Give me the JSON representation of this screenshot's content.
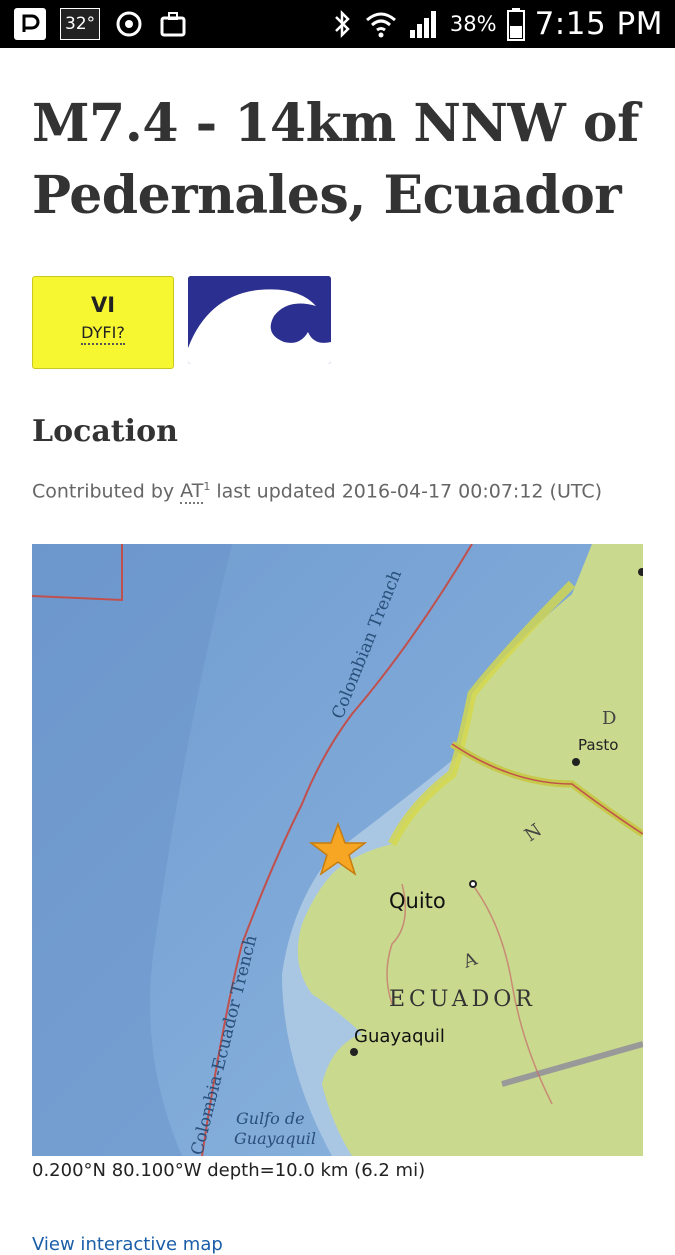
{
  "status_bar": {
    "temperature": "32°",
    "battery": "38%",
    "time": "7:15 PM"
  },
  "event": {
    "title": "M7.4 - 14km NNW of Pedernales, Ecuador"
  },
  "badges": {
    "dyfi_level": "VI",
    "dyfi_label": "DYFI?",
    "dyfi_color": "#f7f731",
    "tsunami_icon": "tsunami-wave-icon",
    "tsunami_color": "#2b2f8f"
  },
  "location": {
    "heading": "Location",
    "contrib_prefix": "Contributed by",
    "contributor": "AT",
    "contrib_sup": "1",
    "updated": "last updated 2016-04-17 00:07:12 (UTC)",
    "coords": "0.200°N 80.100°W depth=10.0 km (6.2 mi)",
    "view_link": "View interactive map"
  },
  "map": {
    "labels": {
      "trench_upper": "Colombian Trench",
      "trench_lower": "Colombia-Ecuador Trench",
      "pasto": "Pasto",
      "quito": "Quito",
      "ecuador": "ECUADOR",
      "guayaquil": "Guayaquil",
      "gulf": "Gulfo de",
      "gulf2": "Guayaquil",
      "andes": "A N D"
    },
    "ocean_color": "#7ea6d6",
    "land_color": "#c9d98e",
    "epicenter_color": "#f7a623"
  }
}
